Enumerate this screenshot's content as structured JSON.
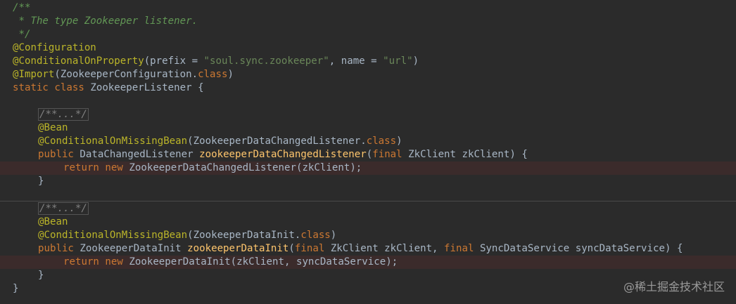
{
  "code": {
    "doc_open": "/**",
    "doc_text": " * The type Zookeeper listener.",
    "doc_close": " */",
    "ann_configuration": "@Configuration",
    "ann_conditional_on_property": "@ConditionalOnProperty",
    "cop_open": "(prefix = ",
    "cop_prefix_value": "\"soul.sync.zookeeper\"",
    "cop_mid": ", name = ",
    "cop_name_value": "\"url\"",
    "cop_close": ")",
    "ann_import": "@Import",
    "import_args": "(ZookeeperConfiguration.",
    "kw_class": "class",
    "close_paren": ")",
    "kw_static": "static",
    "kw_class_decl": "class",
    "class_decl_rest": " ZookeeperListener {",
    "folded_doc": "/**...*/",
    "ann_bean": "@Bean",
    "ann_conditional_on_missing_bean": "@ConditionalOnMissingBean",
    "m1_ann_args": "(ZookeeperDataChangedListener.",
    "kw_public": "public",
    "m1_return_type": " DataChangedListener ",
    "m1_name": "zookeeperDataChangedListener",
    "open_paren": "(",
    "kw_final": "final",
    "m1_params_rest": " ZkClient zkClient) {",
    "kw_return": "return",
    "kw_new": "new",
    "m1_body_rest": " ZookeeperDataChangedListener(zkClient);",
    "close_brace": "}",
    "m2_ann_args": "(ZookeeperDataInit.",
    "m2_return_type": " ZookeeperDataInit ",
    "m2_name": "zookeeperDataInit",
    "m2_param1": " ZkClient zkClient, ",
    "m2_param2_rest": " SyncDataService syncDataService) {",
    "m2_body_rest": " ZookeeperDataInit(zkClient, syncDataService);",
    "outer_close": "}",
    "space": " "
  },
  "watermark": "@稀土掘金技术社区",
  "colors": {
    "background": "#2b2b2b",
    "comment": "#629755",
    "annotation": "#bbb529",
    "keyword": "#cc7832",
    "string": "#6a8759",
    "method": "#ffc66d",
    "identifier": "#a9b7c6",
    "highlight_line": "#3b2b2b"
  }
}
